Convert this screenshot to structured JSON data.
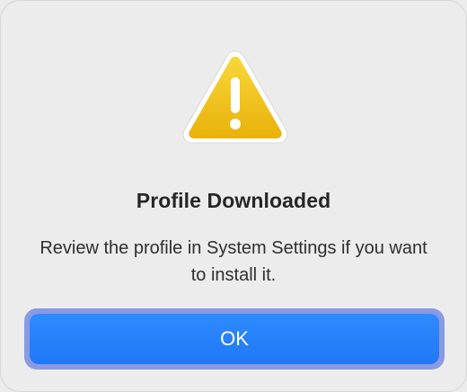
{
  "dialog": {
    "icon": "warning-triangle-icon",
    "title": "Profile Downloaded",
    "message": "Review the profile in System Settings if you want to install it.",
    "ok_label": "OK"
  },
  "colors": {
    "background": "#ececec",
    "accent": "#1f78f5",
    "focus_ring": "#8a99e3",
    "warning_yellow": "#f2c20f"
  }
}
